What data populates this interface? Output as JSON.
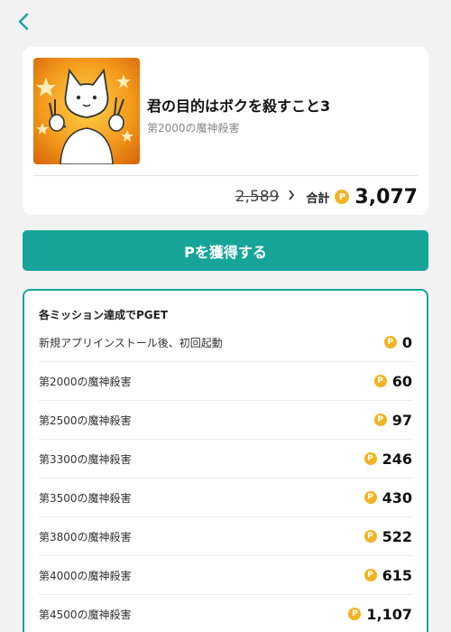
{
  "app": {
    "title": "君の目的はボクを殺すこと3",
    "subtitle": "第2000の魔神殺害",
    "old_price": "2,589",
    "total_label": "合計",
    "total_value": "3,077"
  },
  "cta": {
    "label": "Pを獲得する"
  },
  "missions": {
    "header": "各ミッション達成でPGET",
    "items": [
      {
        "label": "新規アプリインストール後、初回起動",
        "points": "0"
      },
      {
        "label": "第2000の魔神殺害",
        "points": "60"
      },
      {
        "label": "第2500の魔神殺害",
        "points": "97"
      },
      {
        "label": "第3300の魔神殺害",
        "points": "246"
      },
      {
        "label": "第3500の魔神殺害",
        "points": "430"
      },
      {
        "label": "第3800の魔神殺害",
        "points": "522"
      },
      {
        "label": "第4000の魔神殺害",
        "points": "615"
      },
      {
        "label": "第4500の魔神殺害",
        "points": "1,107"
      }
    ]
  },
  "icons": {
    "back": "chevron-left-icon",
    "coin": "point-coin-icon",
    "chevron": "chevron-right-icon"
  },
  "colors": {
    "accent": "#17a599",
    "coin": "#f3b325",
    "background": "#f2f2f2"
  }
}
